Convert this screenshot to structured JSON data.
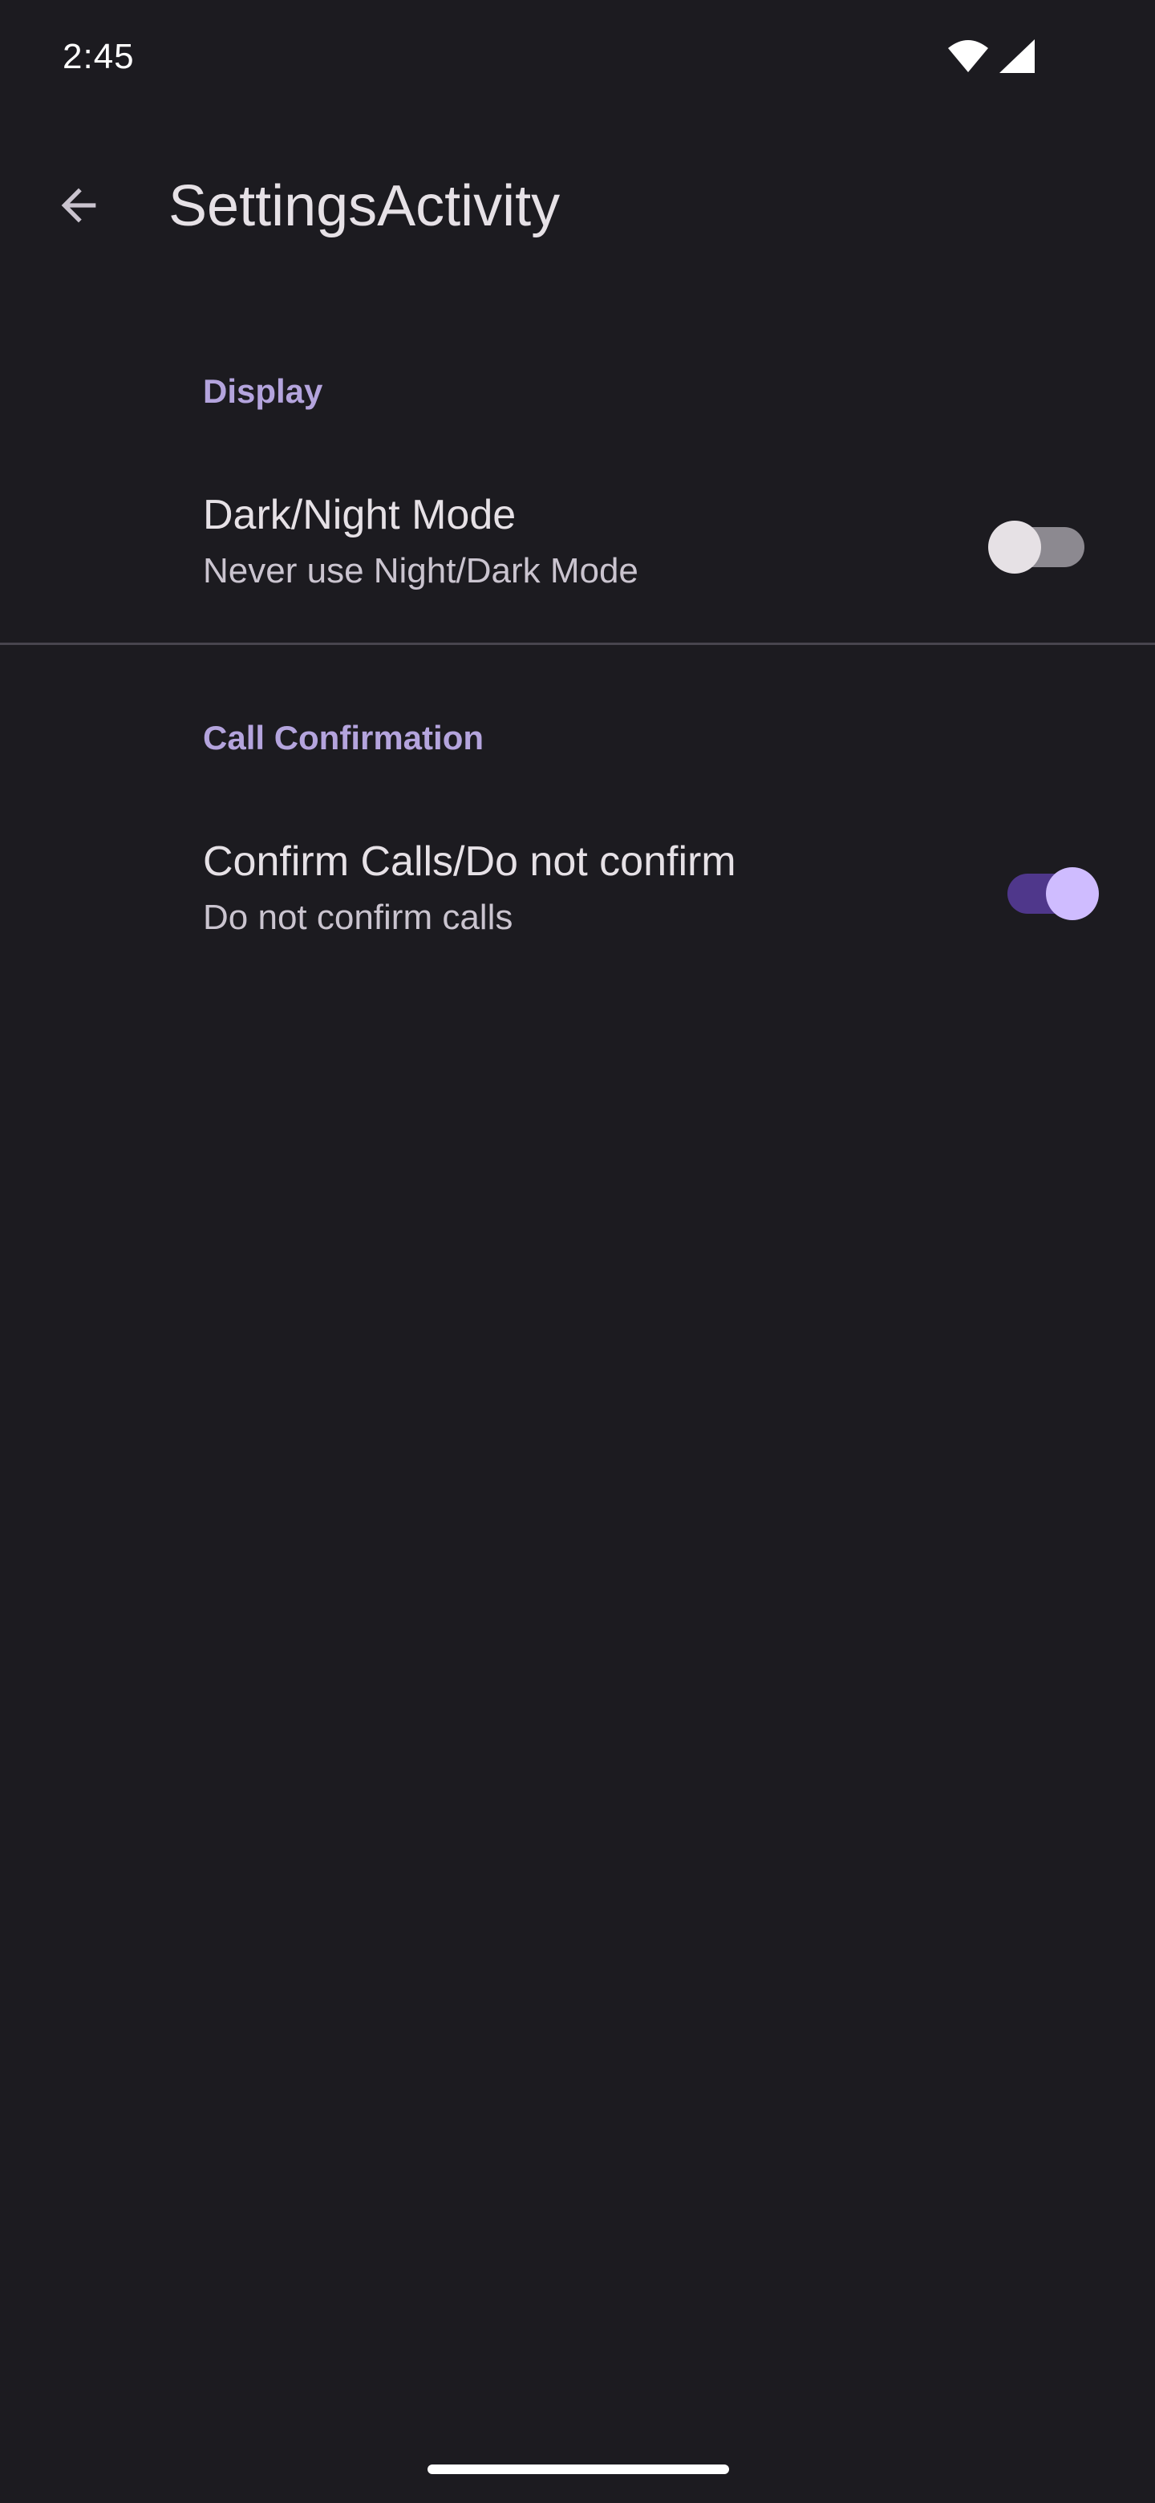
{
  "status_bar": {
    "time": "2:45",
    "icons": [
      "wifi-icon",
      "cell-signal-icon"
    ]
  },
  "app_bar": {
    "title": "SettingsActivity",
    "back_icon": "arrow-back-icon"
  },
  "sections": [
    {
      "category": "Display",
      "preference": {
        "title": "Dark/Night Mode",
        "summary": "Never use Night/Dark Mode",
        "switch_on": false
      }
    },
    {
      "category": "Call Confirmation",
      "preference": {
        "title": "Confirm Calls/Do not confirm",
        "summary": "Do not confirm calls",
        "switch_on": true
      }
    }
  ],
  "colors": {
    "background": "#1c1b20",
    "accent": "#cfbcff",
    "switch_on_track": "#4f378b",
    "switch_off_track": "#8c8990"
  }
}
